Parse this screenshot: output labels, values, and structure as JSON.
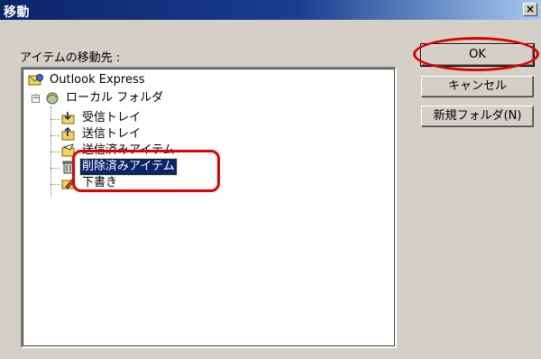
{
  "window": {
    "title": "移動",
    "close_glyph": "×"
  },
  "destination_label": "アイテムの移動先 :",
  "tree": {
    "root": {
      "label": "Outlook Express",
      "icon": "outlook-express-icon"
    },
    "local": {
      "label": "ローカル フォルダ",
      "icon": "local-folders-icon",
      "expander": "−"
    },
    "folders": [
      {
        "label": "受信トレイ",
        "icon": "inbox-icon"
      },
      {
        "label": "送信トレイ",
        "icon": "outbox-icon"
      },
      {
        "label": "送信済みアイテム",
        "icon": "sent-items-icon"
      },
      {
        "label": "削除済みアイテム",
        "icon": "deleted-items-icon",
        "selected": true
      },
      {
        "label": "下書き",
        "icon": "drafts-icon"
      }
    ]
  },
  "buttons": {
    "ok": "OK",
    "cancel": "キャンセル",
    "new_folder": "新規フォルダ(N)"
  },
  "colors": {
    "accent_title": "#0a246a",
    "selection": "#0a246a",
    "highlight_mark": "#e00000",
    "dialog_bg": "#d4d0c8"
  }
}
